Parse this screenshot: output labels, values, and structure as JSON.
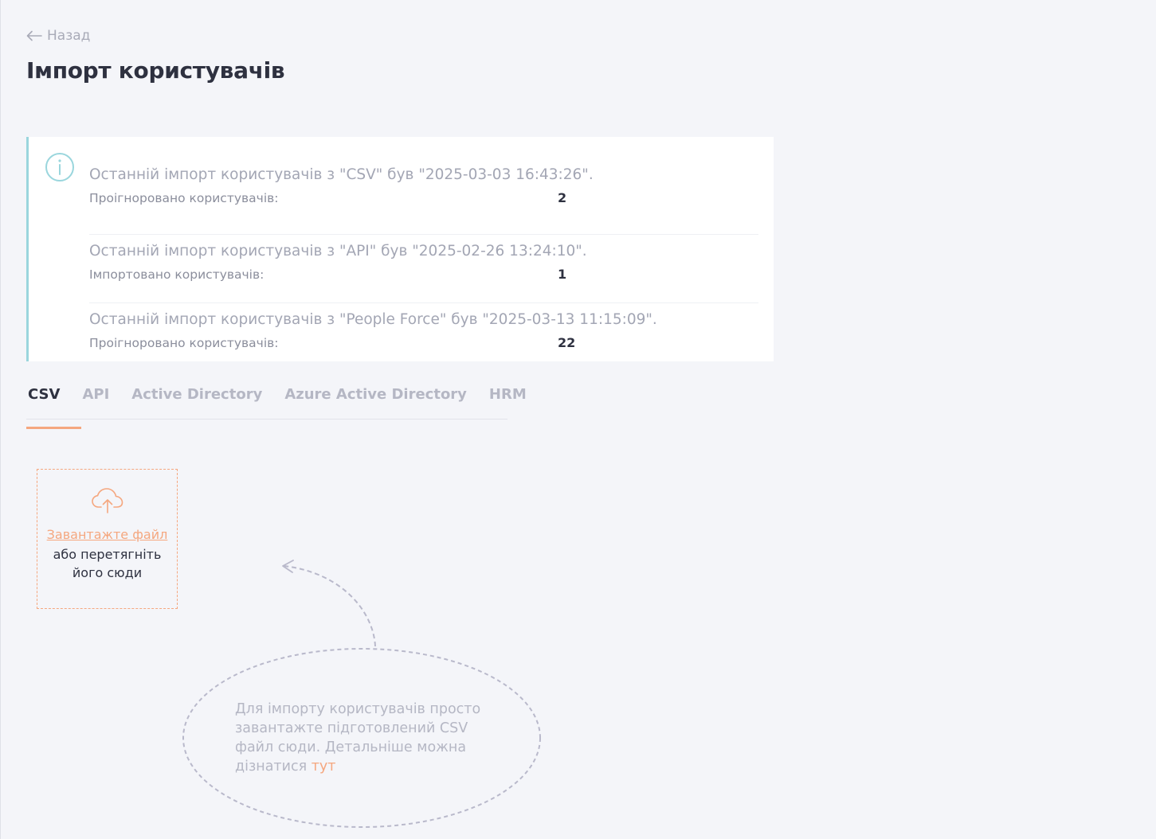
{
  "nav": {
    "back_label": "Назад"
  },
  "page": {
    "title": "Імпорт користувачів"
  },
  "import_history": [
    {
      "headline": "Останній імпорт користувачів з \"CSV\" був \"2025-03-03 16:43:26\".",
      "stat_label": "Проігноровано користувачів:",
      "stat_value": "2"
    },
    {
      "headline": "Останній імпорт користувачів з \"API\" був \"2025-02-26 13:24:10\".",
      "stat_label": "Імпортовано користувачів:",
      "stat_value": "1"
    },
    {
      "headline": "Останній імпорт користувачів з \"People Force\" був \"2025-03-13 11:15:09\".",
      "stat_label": "Проігноровано користувачів:",
      "stat_value": "22"
    }
  ],
  "tabs": [
    {
      "label": "CSV",
      "active": true
    },
    {
      "label": "API",
      "active": false
    },
    {
      "label": "Active Directory",
      "active": false
    },
    {
      "label": "Azure Active Directory",
      "active": false
    },
    {
      "label": "HRM",
      "active": false
    }
  ],
  "dropzone": {
    "icon": "cloud-upload-icon",
    "upload_link": "Завантажте файл",
    "hint_line1": "або перетягніть",
    "hint_line2": "його сюди"
  },
  "help_bubble": {
    "text": "Для імпорту користувачів просто завантажте підготовлений CSV файл сюди. Детальніше можна дізнатися ",
    "link": "тут"
  },
  "colors": {
    "accent": "#f5a77f",
    "info_border": "#9ad6dd",
    "background": "#f4f5f9",
    "title": "#2e3140",
    "muted": "#a3a6b4"
  }
}
